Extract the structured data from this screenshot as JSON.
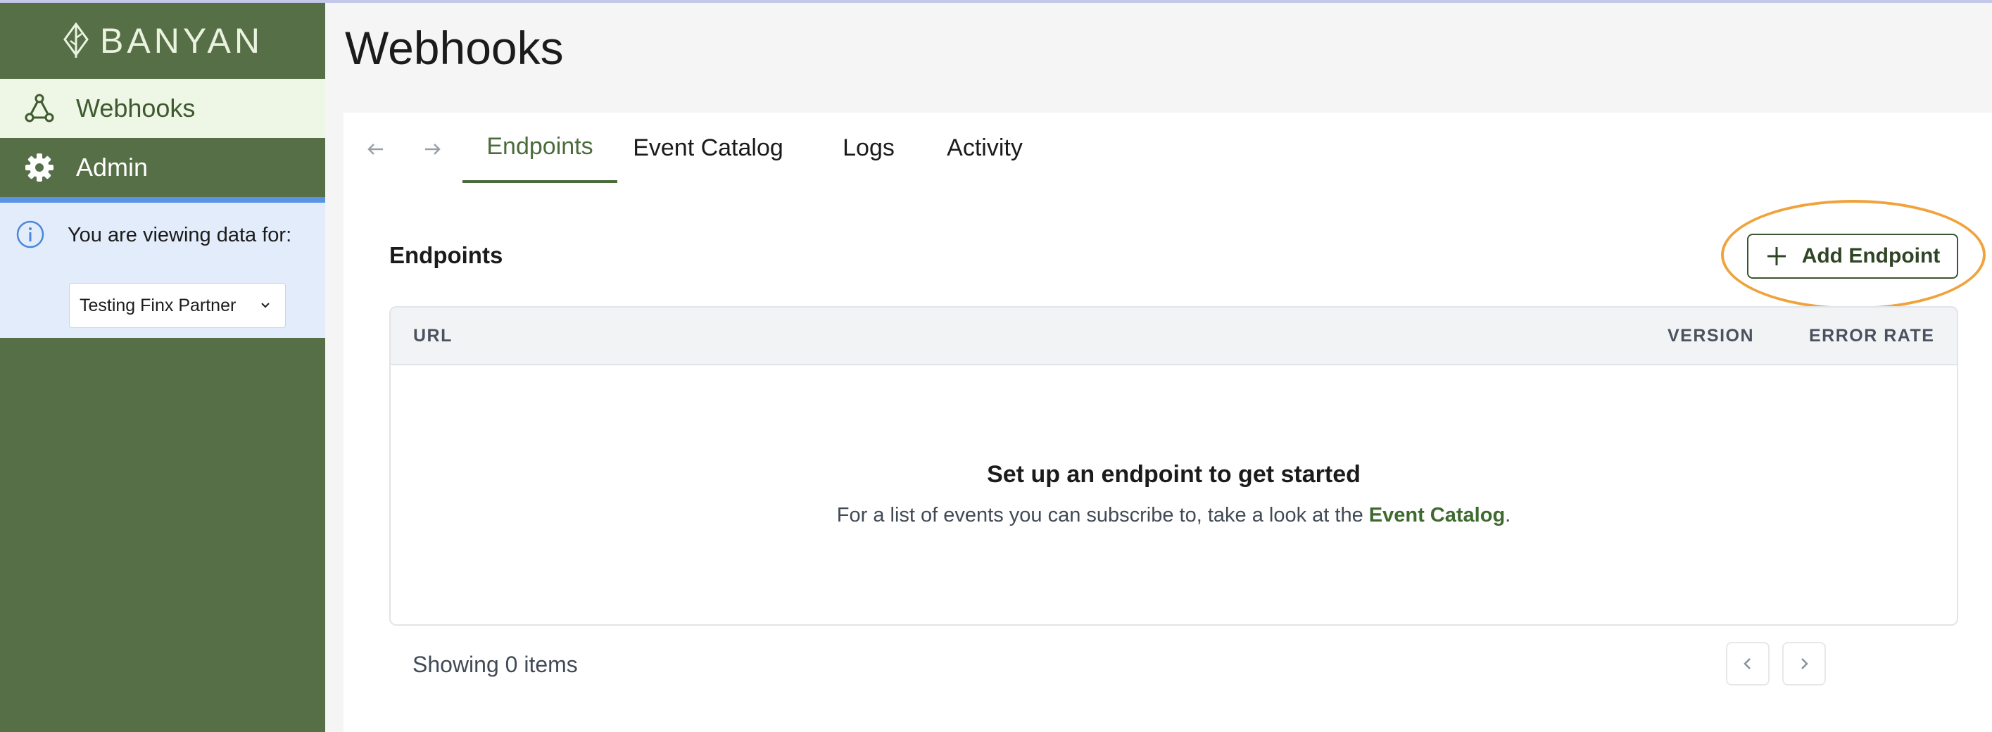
{
  "brand": {
    "name": "BANYAN",
    "icon": "leaf-logo-icon"
  },
  "sidebar": {
    "items": [
      {
        "label": "Webhooks",
        "icon": "webhook-icon",
        "active": true
      },
      {
        "label": "Admin",
        "icon": "gear-icon",
        "active": false
      }
    ],
    "info": {
      "text": "You are viewing data for:",
      "icon": "info-icon",
      "account": "Testing Finx Partner"
    }
  },
  "page": {
    "title": "Webhooks"
  },
  "tabs": [
    {
      "label": "Endpoints",
      "active": true
    },
    {
      "label": "Event Catalog",
      "active": false
    },
    {
      "label": "Logs",
      "active": false
    },
    {
      "label": "Activity",
      "active": false
    }
  ],
  "endpoints": {
    "title": "Endpoints",
    "add_button": "Add Endpoint",
    "columns": [
      "URL",
      "VERSION",
      "ERROR RATE"
    ],
    "empty_title": "Set up an endpoint to get started",
    "empty_prefix": "For a list of events you can subscribe to, take a look at the ",
    "empty_link": "Event Catalog",
    "empty_suffix": ".",
    "count_text": "Showing 0 items"
  },
  "colors": {
    "sidebar": "#566f47",
    "accent": "#4a6b3a",
    "highlight": "#f0a33c",
    "info_bg": "#e2ecfa"
  }
}
